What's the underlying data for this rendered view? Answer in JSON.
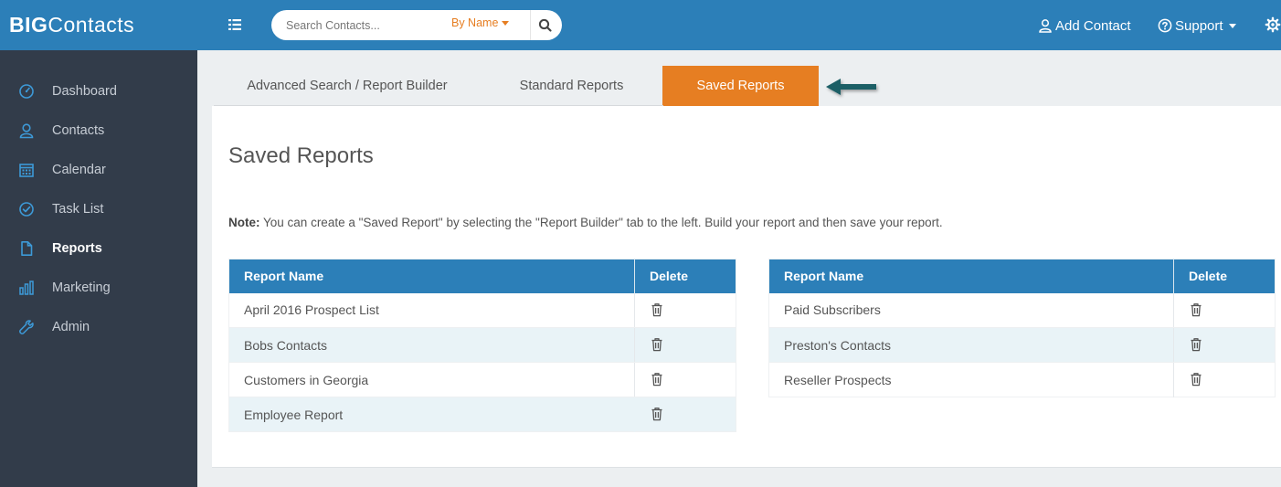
{
  "header": {
    "logo_bold": "BIG",
    "logo_rest": "Contacts",
    "search_placeholder": "Search Contacts...",
    "search_mode": "By Name",
    "add_contact_label": "Add Contact",
    "support_label": "Support",
    "icons": [
      "menu-icon",
      "search-icon",
      "user-icon",
      "question-circle-icon",
      "gear-icon"
    ]
  },
  "sidebar": {
    "items": [
      {
        "label": "Dashboard",
        "icon": "gauge-icon"
      },
      {
        "label": "Contacts",
        "icon": "user-icon"
      },
      {
        "label": "Calendar",
        "icon": "calendar-icon"
      },
      {
        "label": "Task List",
        "icon": "check-circle-icon"
      },
      {
        "label": "Reports",
        "icon": "document-icon",
        "active": true
      },
      {
        "label": "Marketing",
        "icon": "bar-chart-icon"
      },
      {
        "label": "Admin",
        "icon": "wrench-icon"
      }
    ]
  },
  "tabs": [
    {
      "label": "Advanced Search / Report Builder"
    },
    {
      "label": "Standard Reports"
    },
    {
      "label": "Saved Reports",
      "active": true
    }
  ],
  "main": {
    "title": "Saved Reports",
    "note_label": "Note:",
    "note_text": "You can create a \"Saved Report\" by selecting the \"Report Builder\" tab to the left. Build your report and then save your report.",
    "columns": [
      "Report Name",
      "Delete"
    ],
    "left_reports": [
      "April 2016 Prospect List",
      "Bobs Contacts",
      "Customers in Georgia",
      "Employee Report"
    ],
    "right_reports": [
      "Paid Subscribers",
      "Preston's Contacts",
      "Reseller Prospects"
    ]
  },
  "colors": {
    "header_blue": "#2c7fb8",
    "sidebar_dark": "#323c4a",
    "active_tab_orange": "#e67e22",
    "row_alt": "#e9f3f7",
    "arrow_teal": "#1f5f66"
  }
}
